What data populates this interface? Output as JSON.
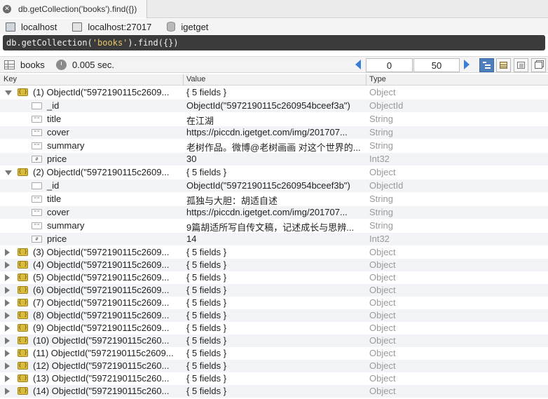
{
  "tab": {
    "title": "db.getCollection('books').find({})"
  },
  "connection": {
    "host": "localhost",
    "server": "localhost:27017",
    "database": "igetget"
  },
  "query": {
    "prefix": "db.getCollection(",
    "arg": "'books'",
    "suffix": ").find({})"
  },
  "toolbar": {
    "collection": "books",
    "time": "0.005 sec.",
    "skip": "0",
    "limit": "50"
  },
  "columns": {
    "key": "Key",
    "value": "Value",
    "type": "Type"
  },
  "rows": [
    {
      "kind": "doc",
      "open": true,
      "key": "(1) ObjectId(\"5972190115c2609...",
      "value": "{ 5 fields }",
      "type": "Object"
    },
    {
      "kind": "field",
      "icon": "",
      "key": "_id",
      "value": "ObjectId(\"5972190115c260954bceef3a\")",
      "type": "ObjectId"
    },
    {
      "kind": "field",
      "icon": "\"\"",
      "key": "title",
      "value": "在江湖",
      "type": "String"
    },
    {
      "kind": "field",
      "icon": "\"\"",
      "key": "cover",
      "value": "https://piccdn.igetget.com/img/201707...",
      "type": "String"
    },
    {
      "kind": "field",
      "icon": "\"\"",
      "key": "summary",
      "value": "老树作品。微博@老树画画 对这个世界的...",
      "type": "String"
    },
    {
      "kind": "field",
      "icon": "#",
      "key": "price",
      "value": "30",
      "type": "Int32"
    },
    {
      "kind": "doc",
      "open": true,
      "key": "(2) ObjectId(\"5972190115c2609...",
      "value": "{ 5 fields }",
      "type": "Object"
    },
    {
      "kind": "field",
      "icon": "",
      "key": "_id",
      "value": "ObjectId(\"5972190115c260954bceef3b\")",
      "type": "ObjectId"
    },
    {
      "kind": "field",
      "icon": "\"\"",
      "key": "title",
      "value": "孤独与大胆：胡适自述",
      "type": "String"
    },
    {
      "kind": "field",
      "icon": "\"\"",
      "key": "cover",
      "value": "https://piccdn.igetget.com/img/201707...",
      "type": "String"
    },
    {
      "kind": "field",
      "icon": "\"\"",
      "key": "summary",
      "value": "9篇胡适所写自传文稿，记述成长与思辨...",
      "type": "String"
    },
    {
      "kind": "field",
      "icon": "#",
      "key": "price",
      "value": "14",
      "type": "Int32"
    },
    {
      "kind": "doc",
      "open": false,
      "key": "(3) ObjectId(\"5972190115c2609...",
      "value": "{ 5 fields }",
      "type": "Object"
    },
    {
      "kind": "doc",
      "open": false,
      "key": "(4) ObjectId(\"5972190115c2609...",
      "value": "{ 5 fields }",
      "type": "Object"
    },
    {
      "kind": "doc",
      "open": false,
      "key": "(5) ObjectId(\"5972190115c2609...",
      "value": "{ 5 fields }",
      "type": "Object"
    },
    {
      "kind": "doc",
      "open": false,
      "key": "(6) ObjectId(\"5972190115c2609...",
      "value": "{ 5 fields }",
      "type": "Object"
    },
    {
      "kind": "doc",
      "open": false,
      "key": "(7) ObjectId(\"5972190115c2609...",
      "value": "{ 5 fields }",
      "type": "Object"
    },
    {
      "kind": "doc",
      "open": false,
      "key": "(8) ObjectId(\"5972190115c2609...",
      "value": "{ 5 fields }",
      "type": "Object"
    },
    {
      "kind": "doc",
      "open": false,
      "key": "(9) ObjectId(\"5972190115c2609...",
      "value": "{ 5 fields }",
      "type": "Object"
    },
    {
      "kind": "doc",
      "open": false,
      "key": "(10) ObjectId(\"5972190115c260...",
      "value": "{ 5 fields }",
      "type": "Object"
    },
    {
      "kind": "doc",
      "open": false,
      "key": "(11) ObjectId(\"5972190115c2609...",
      "value": "{ 5 fields }",
      "type": "Object"
    },
    {
      "kind": "doc",
      "open": false,
      "key": "(12) ObjectId(\"5972190115c260...",
      "value": "{ 5 fields }",
      "type": "Object"
    },
    {
      "kind": "doc",
      "open": false,
      "key": "(13) ObjectId(\"5972190115c260...",
      "value": "{ 5 fields }",
      "type": "Object"
    },
    {
      "kind": "doc",
      "open": false,
      "key": "(14) ObjectId(\"5972190115c260...",
      "value": "{ 5 fields }",
      "type": "Object"
    }
  ]
}
